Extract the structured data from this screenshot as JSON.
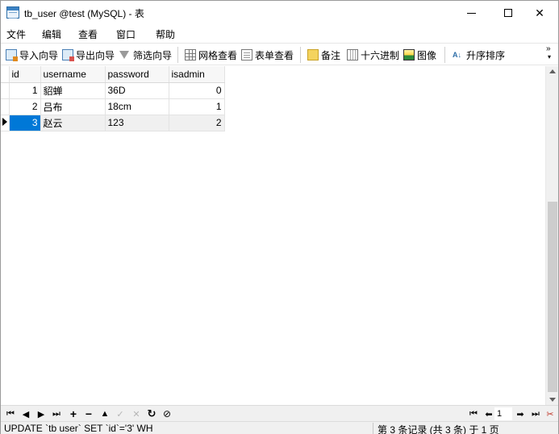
{
  "window": {
    "title": "tb_user @test (MySQL) - 表"
  },
  "menubar": {
    "items": [
      "文件",
      "编辑",
      "查看",
      "窗口",
      "帮助"
    ]
  },
  "toolbar": {
    "import_wizard": "导入向导",
    "export_wizard": "导出向导",
    "filter_wizard": "筛选向导",
    "grid_view": "网格查看",
    "form_view": "表单查看",
    "memo": "备注",
    "hex": "十六进制",
    "image": "图像",
    "sort": "升序排序",
    "more": "»"
  },
  "grid": {
    "columns": [
      "id",
      "username",
      "password",
      "isadmin"
    ],
    "rows": [
      {
        "id": "1",
        "username": "貂蝉",
        "password": "36D",
        "isadmin": "0"
      },
      {
        "id": "2",
        "username": "吕布",
        "password": "18cm",
        "isadmin": "1"
      },
      {
        "id": "3",
        "username": "赵云",
        "password": "123",
        "isadmin": "2"
      }
    ],
    "selected_row": 3
  },
  "navigator": {
    "page": "1"
  },
  "status": {
    "sql": "UPDATE `tb user` SET `id`='3' WH",
    "records": "第 3 条记录 (共 3 条) 于 1 页"
  },
  "colors": {
    "selection": "#0078d7",
    "row_highlight": "#f0f0f0"
  }
}
